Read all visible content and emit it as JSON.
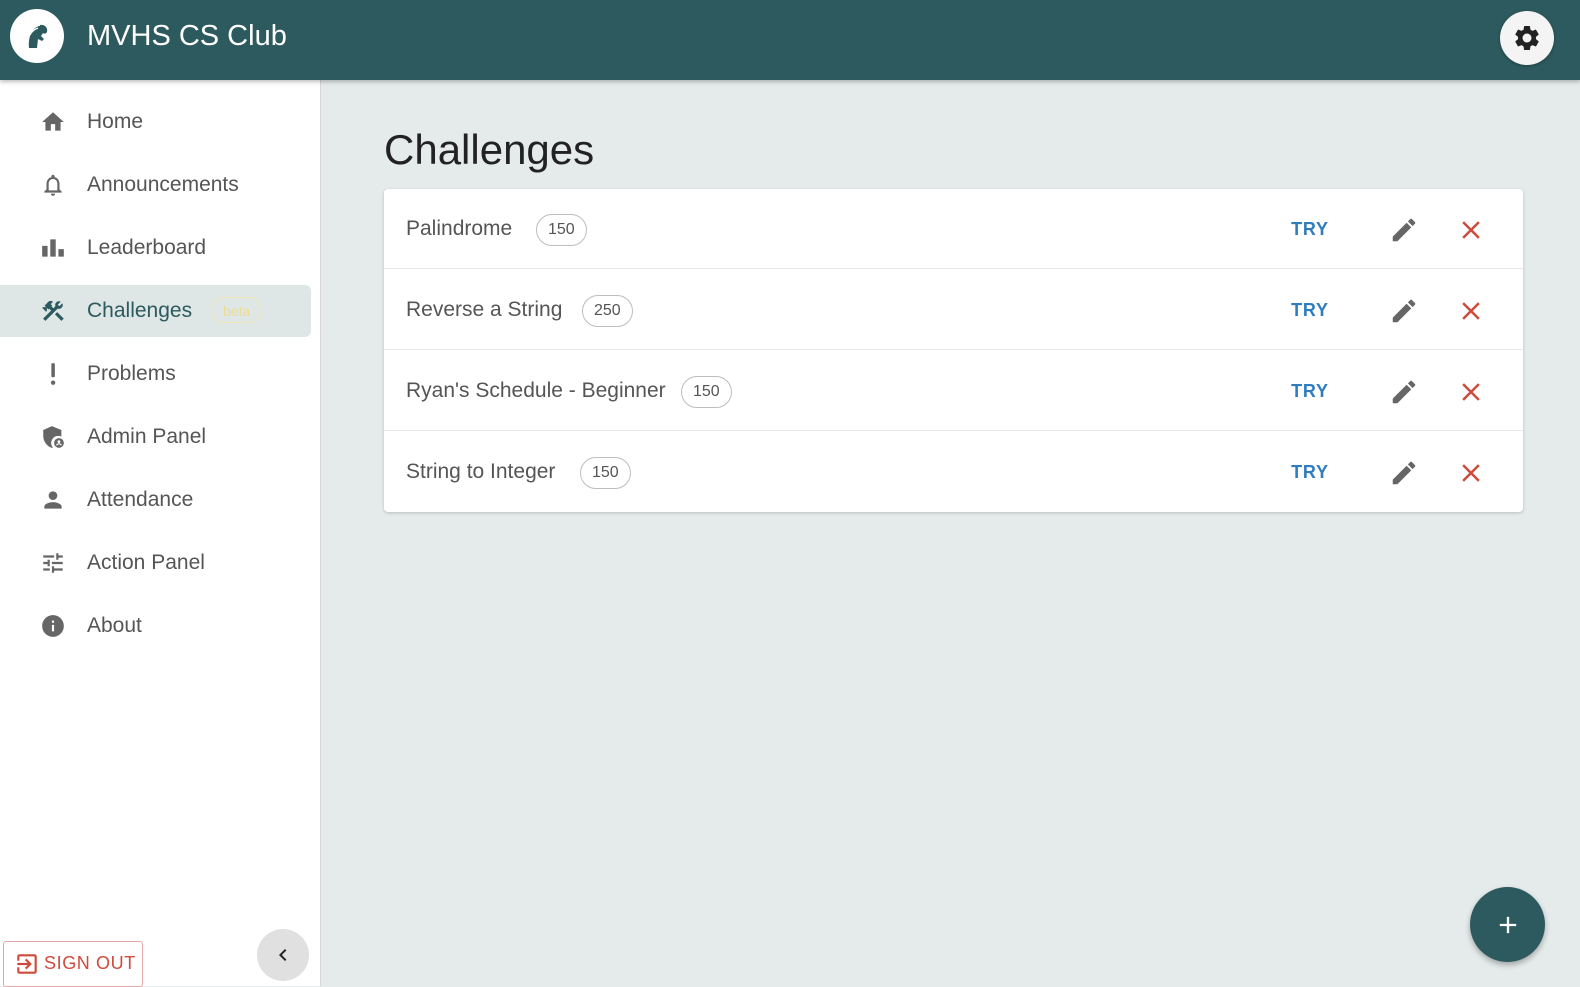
{
  "app": {
    "title": "MVHS CS Club"
  },
  "header": {
    "logo_icon": "spartan-helmet-icon",
    "settings_icon": "gear-icon"
  },
  "sidebar": {
    "items": [
      {
        "label": "Home",
        "icon": "home-icon"
      },
      {
        "label": "Announcements",
        "icon": "bell-icon"
      },
      {
        "label": "Leaderboard",
        "icon": "bar-chart-icon"
      },
      {
        "label": "Challenges",
        "icon": "tools-icon",
        "badge": "beta",
        "active": true
      },
      {
        "label": "Problems",
        "icon": "exclamation-icon"
      },
      {
        "label": "Admin Panel",
        "icon": "admin-shield-icon"
      },
      {
        "label": "Attendance",
        "icon": "person-icon"
      },
      {
        "label": "Action Panel",
        "icon": "sliders-icon"
      },
      {
        "label": "About",
        "icon": "info-icon"
      }
    ],
    "sign_out_label": "SIGN OUT",
    "collapse_icon": "chevron-left-icon"
  },
  "main": {
    "title": "Challenges",
    "challenges": [
      {
        "title": "Palindrome",
        "points": "150",
        "try_label": "TRY"
      },
      {
        "title": "Reverse a String",
        "points": "250",
        "try_label": "TRY"
      },
      {
        "title": "Ryan's Schedule - Beginner",
        "points": "150",
        "try_label": "TRY"
      },
      {
        "title": "String to Integer",
        "points": "150",
        "try_label": "TRY"
      }
    ],
    "fab_icon": "plus-icon"
  },
  "colors": {
    "primary": "#2d5a5e",
    "accent_link": "#2f7cbf",
    "danger": "#d04a3c",
    "beta": "#ecdc95"
  }
}
